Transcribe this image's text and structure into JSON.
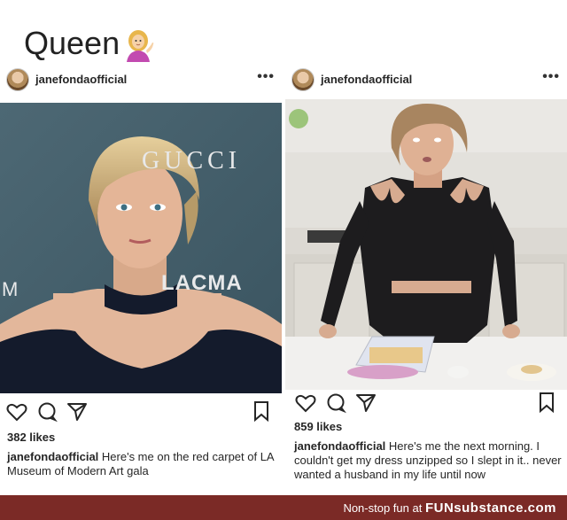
{
  "header": {
    "title": "Queen",
    "emoji_icon": "woman-tipping-hand-icon"
  },
  "posts": [
    {
      "username": "janefondaofficial",
      "more_label": "•••",
      "likes": "382 likes",
      "caption_user": "janefondaofficial",
      "caption_text": " Here's me on the red carpet of LA Museum of Modern Art gala",
      "photo_text": {
        "brand1": "GUCCI",
        "brand2": "LACMA",
        "brand_left": "M"
      }
    },
    {
      "username": "janefondaofficial",
      "more_label": "•••",
      "likes": "859 likes",
      "caption_user": "janefondaofficial",
      "caption_text": " Here's me the next morning. I couldn't get my dress unzipped so I slept in it.. never wanted a husband in my life until now"
    }
  ],
  "footer": {
    "prefix": "Non-stop fun at",
    "brand": "FUNsubstance.com"
  },
  "colors": {
    "footer_bg": "#7b2a26",
    "text": "#262626"
  }
}
